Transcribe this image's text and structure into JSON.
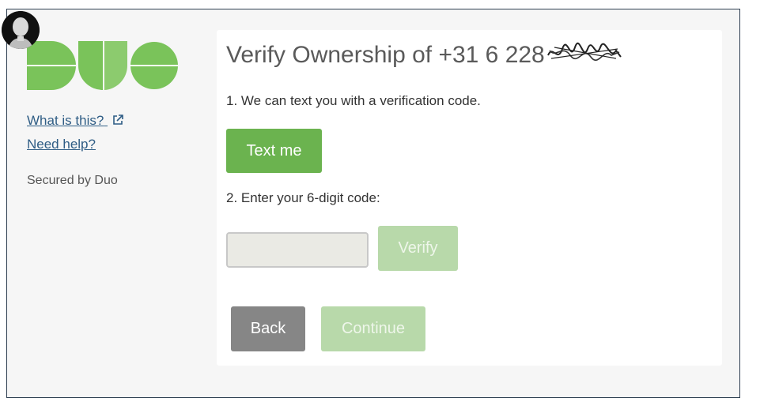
{
  "sidebar": {
    "logo_alt": "Duo",
    "what_is_this": "What is this?",
    "need_help": "Need help?",
    "secured_by": "Secured by Duo"
  },
  "main": {
    "title": "Verify Ownership of +31 6 228",
    "step1": "1. We can text you with a verification code.",
    "text_me_button": "Text me",
    "step2": "2. Enter your 6-digit code:",
    "code_input": {
      "value": "",
      "placeholder": ""
    },
    "verify_button": "Verify",
    "back_button": "Back",
    "continue_button": "Continue"
  },
  "colors": {
    "brand_green": "#6bb34f",
    "disabled_green": "#b8d9aa",
    "back_gray": "#868686",
    "link_blue": "#2f5d85"
  }
}
